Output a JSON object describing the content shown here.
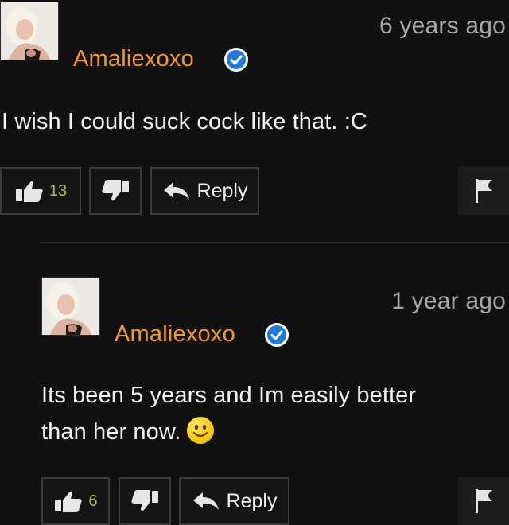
{
  "comments": [
    {
      "username": "Amaliexoxo",
      "timestamp": "6 years ago",
      "text": "I wish I could suck cock like that. :C",
      "likes": "13",
      "reply_label": "Reply"
    },
    {
      "username": "Amaliexoxo",
      "timestamp": "1 year ago",
      "text_line1": "Its been 5 years and Im easily better",
      "text_line2": "than her now.",
      "likes": "6",
      "reply_label": "Reply"
    }
  ],
  "colors": {
    "background": "#111111",
    "username": "#f39a1f",
    "like_count": "#a8c13b",
    "verified": "#1f7ae0"
  },
  "icons": [
    "thumbs-up-icon",
    "thumbs-down-icon",
    "reply-arrow-icon",
    "flag-icon",
    "verified-check-icon",
    "smiley-emoji-icon"
  ]
}
